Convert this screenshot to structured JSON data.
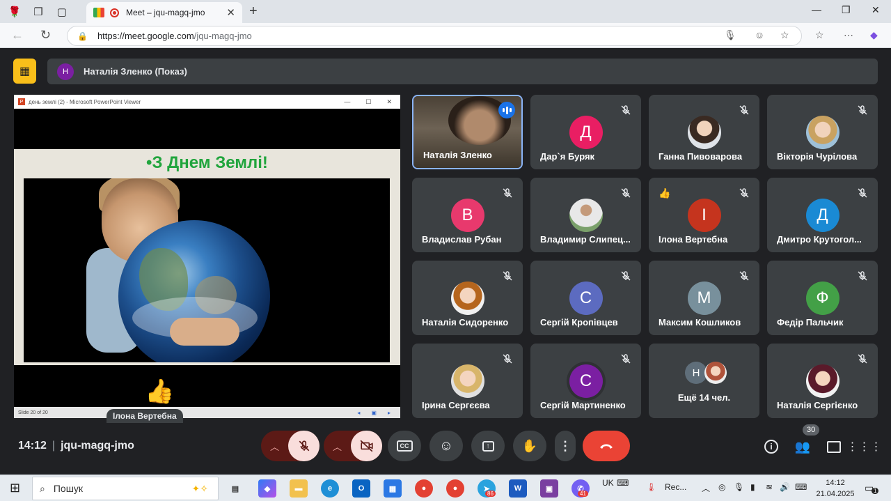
{
  "browser": {
    "tab_title": "Meet – jqu-magq-jmo",
    "url_host": "https://meet.google.com",
    "url_path": "/jqu-magq-jmo"
  },
  "meet": {
    "presenter_initial": "Н",
    "presenter_label": "Наталія Зленко (Показ)",
    "ppt_window_title": "день землі (2) - Microsoft PowerPoint Viewer",
    "slide_title": "•З Днем Землі!",
    "slide_status": "Slide 20 of 20",
    "presentation_name_chip": "Ілона Вертебна",
    "participants": [
      {
        "name": "Наталія Зленко"
      },
      {
        "name": "Дар`я Буряк",
        "initial": "Д",
        "color": "#e91e63"
      },
      {
        "name": "Ганна Пивоварова"
      },
      {
        "name": "Вікторія Чурілова"
      },
      {
        "name": "Владислав Рубан",
        "initial": "В",
        "color": "#e8396d"
      },
      {
        "name": "Владимир Слипец..."
      },
      {
        "name": "Ілона Вертебна",
        "initial": "І",
        "color": "#c5341e"
      },
      {
        "name": "Дмитро Крутогол...",
        "initial": "Д",
        "color": "#1a8ad4"
      },
      {
        "name": "Наталія Сидоренко"
      },
      {
        "name": "Сергій Кропівцев",
        "initial": "С",
        "color": "#5c6bc0"
      },
      {
        "name": "Максим Кошликов",
        "initial": "М",
        "color": "#78909c"
      },
      {
        "name": "Федір Пальчик",
        "initial": "Ф",
        "color": "#43a047"
      },
      {
        "name": "Ірина Сергєєва"
      },
      {
        "name": "Сергій Мартиненко",
        "initial": "С",
        "color": "#7b1fa2"
      },
      {
        "name": "Ещё 14 чел.",
        "initial": "Н",
        "color": "#5f6e7a"
      },
      {
        "name": "Наталія Сергієнко"
      }
    ],
    "time": "14:12",
    "meeting_code": "jqu-magq-jmo",
    "participant_count": "30"
  },
  "taskbar": {
    "search_placeholder": "Пошук",
    "lang": "UK",
    "rec_label": "Rec...",
    "edge_badge": "86",
    "viber_badge": "41",
    "clock_time": "14:12",
    "clock_date": "21.04.2025",
    "notif_count": "1"
  }
}
